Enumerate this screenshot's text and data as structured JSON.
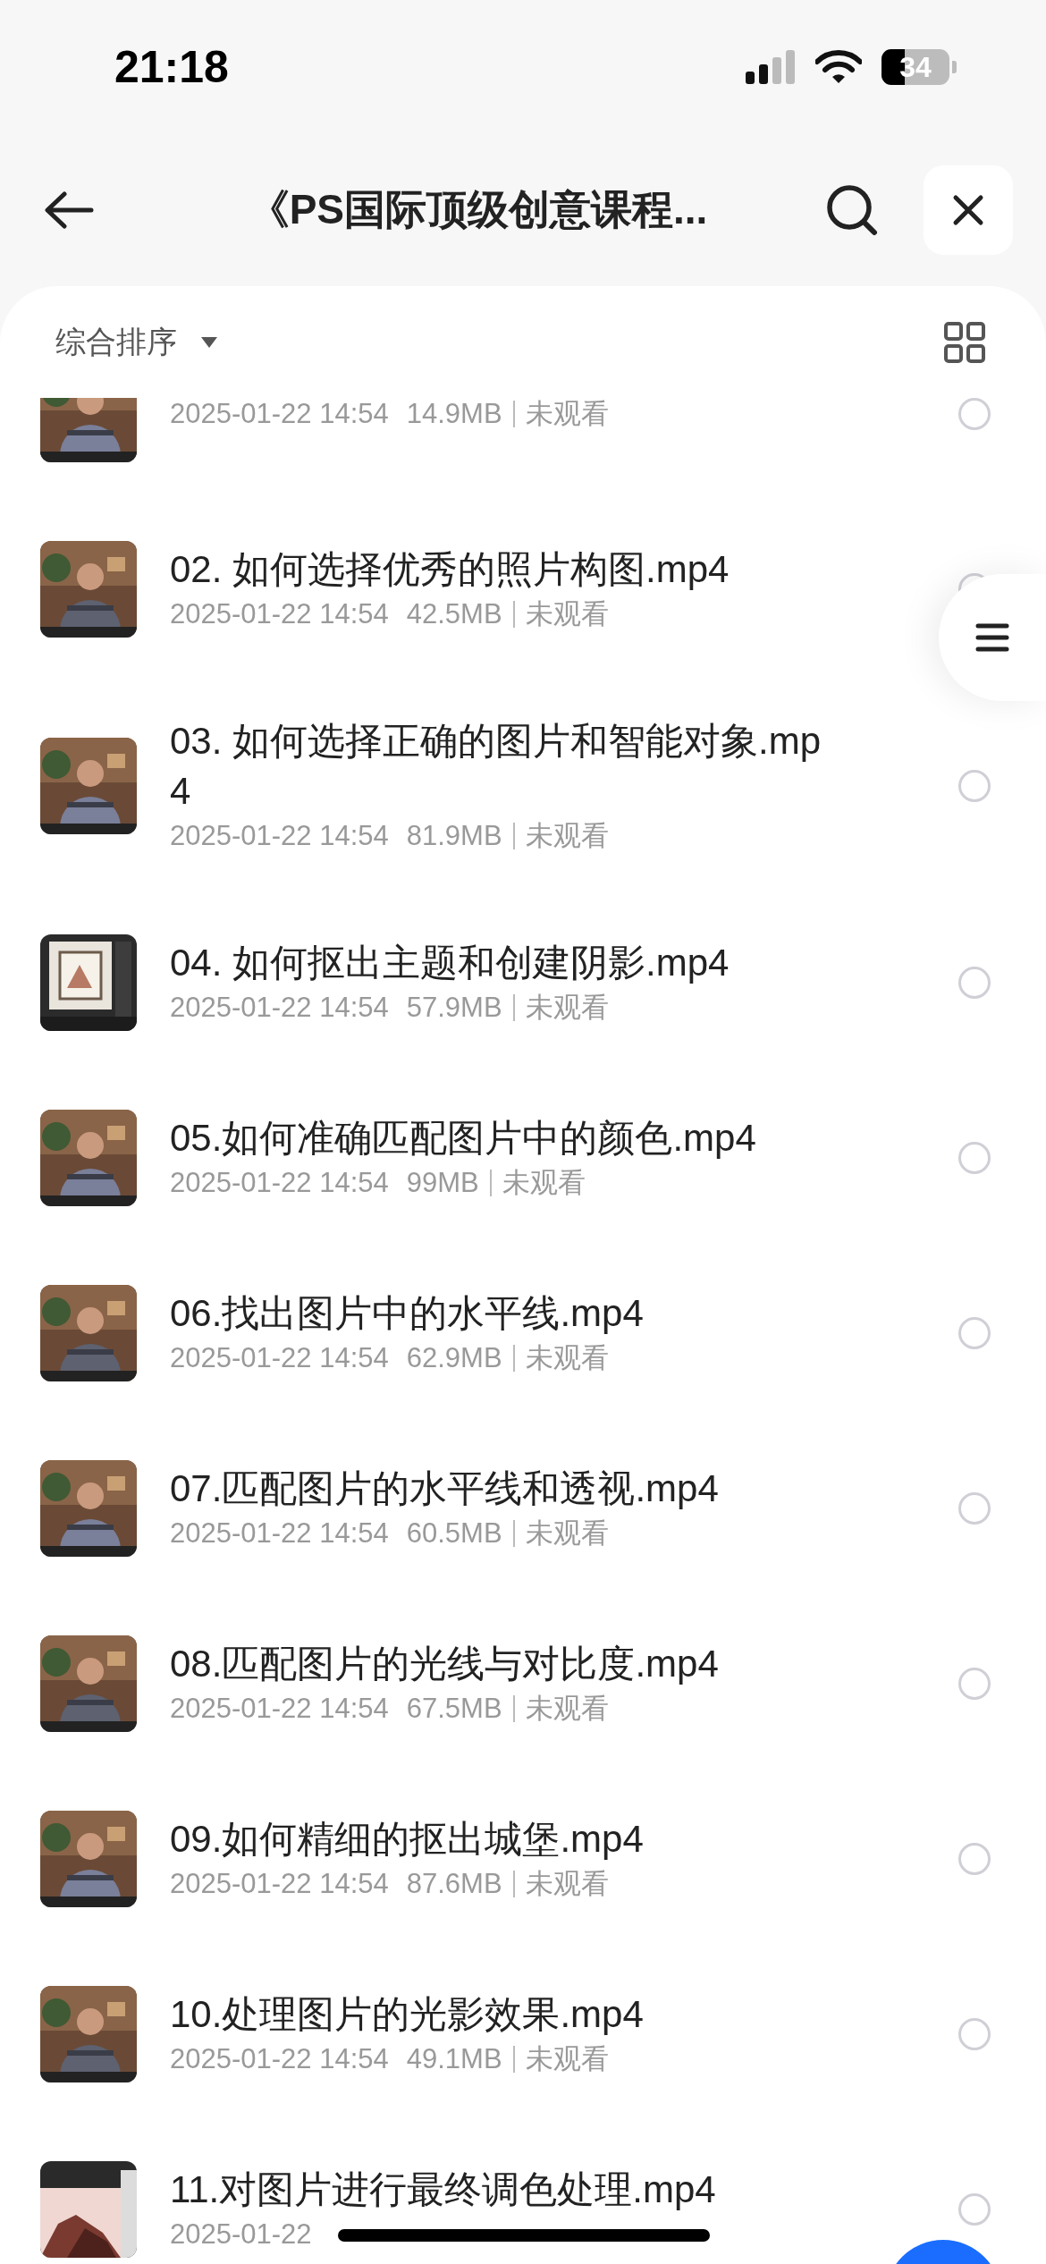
{
  "status_bar": {
    "time": "21:18",
    "battery": "34"
  },
  "header": {
    "title": "《PS国际顶级创意课程..."
  },
  "toolbar": {
    "sort": "综合排序"
  },
  "files": [
    {
      "date": "2025-01-22 14:54",
      "size": "14.9MB",
      "status": "未观看",
      "selected": false
    },
    {
      "title": "02. 如何选择优秀的照片构图.mp4",
      "date": "2025-01-22 14:54",
      "size": "42.5MB",
      "status": "未观看",
      "selected": false
    },
    {
      "title": "03. 如何选择正确的图片和智能对象.mp4",
      "date": "2025-01-22 14:54",
      "size": "81.9MB",
      "status": "未观看",
      "selected": false
    },
    {
      "title": "04. 如何抠出主题和创建阴影.mp4",
      "date": "2025-01-22 14:54",
      "size": "57.9MB",
      "status": "未观看",
      "selected": false
    },
    {
      "title": "05.如何准确匹配图片中的颜色.mp4",
      "date": "2025-01-22 14:54",
      "size": "99MB",
      "status": "未观看",
      "selected": false
    },
    {
      "title": "06.找出图片中的水平线.mp4",
      "date": "2025-01-22 14:54",
      "size": "62.9MB",
      "status": "未观看",
      "selected": false
    },
    {
      "title": "07.匹配图片的水平线和透视.mp4",
      "date": "2025-01-22 14:54",
      "size": "60.5MB",
      "status": "未观看",
      "selected": false
    },
    {
      "title": "08.匹配图片的光线与对比度.mp4",
      "date": "2025-01-22 14:54",
      "size": "67.5MB",
      "status": "未观看",
      "selected": false
    },
    {
      "title": "09.如何精细的抠出城堡.mp4",
      "date": "2025-01-22 14:54",
      "size": "87.6MB",
      "status": "未观看",
      "selected": false
    },
    {
      "title": "10.处理图片的光影效果.mp4",
      "date": "2025-01-22 14:54",
      "size": "49.1MB",
      "status": "未观看",
      "selected": false
    },
    {
      "title": "11.对图片进行最终调色处理.mp4",
      "date": "2025-01-22",
      "selected": false
    }
  ]
}
